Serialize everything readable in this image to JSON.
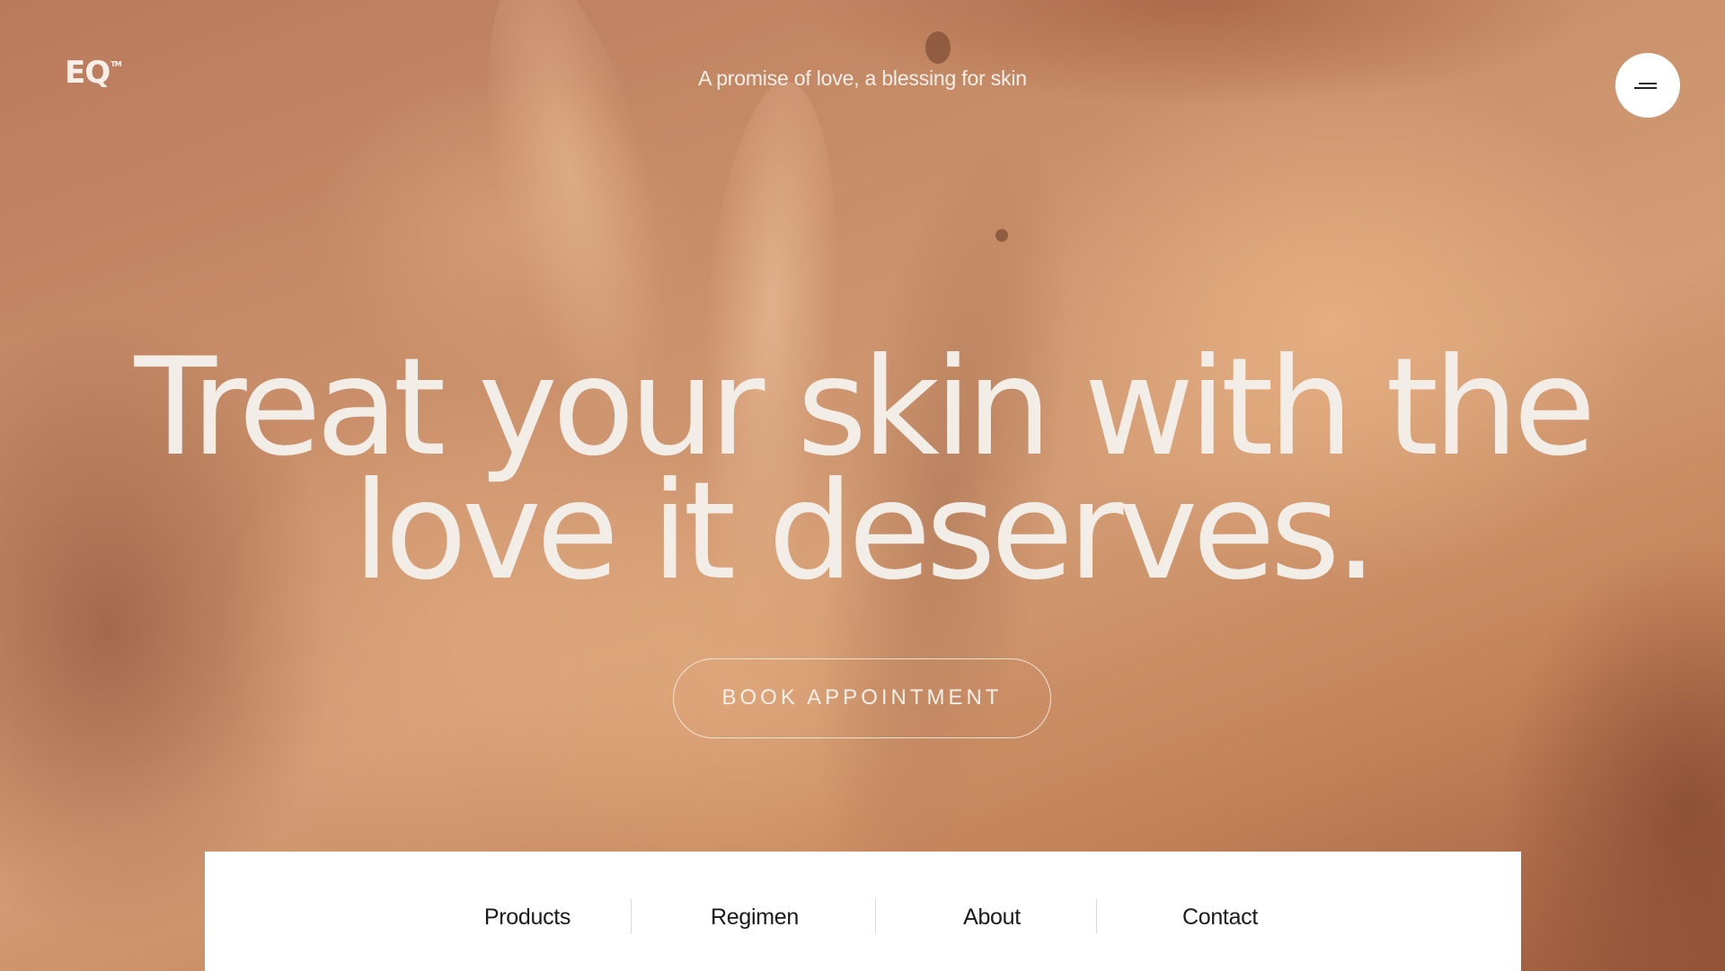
{
  "header": {
    "logo_text": "EQ",
    "logo_mark": "TM",
    "tagline": "A promise of love, a blessing for skin",
    "menu_icon": "menu-icon"
  },
  "hero": {
    "headline_line1": "Treat your skin with the",
    "headline_line2": "love it deserves.",
    "cta_label": "BOOK APPOINTMENT",
    "background_image": "close-up photo of hand on bare neck and shoulder"
  },
  "bottom_nav": {
    "items": [
      {
        "label": "Products"
      },
      {
        "label": "Regimen"
      },
      {
        "label": "About"
      },
      {
        "label": "Contact"
      }
    ]
  },
  "colors": {
    "hero_text": "#f3ede8",
    "nav_background": "#ffffff",
    "nav_text": "#1a1a1a",
    "skin_tone": "#c78d68"
  }
}
